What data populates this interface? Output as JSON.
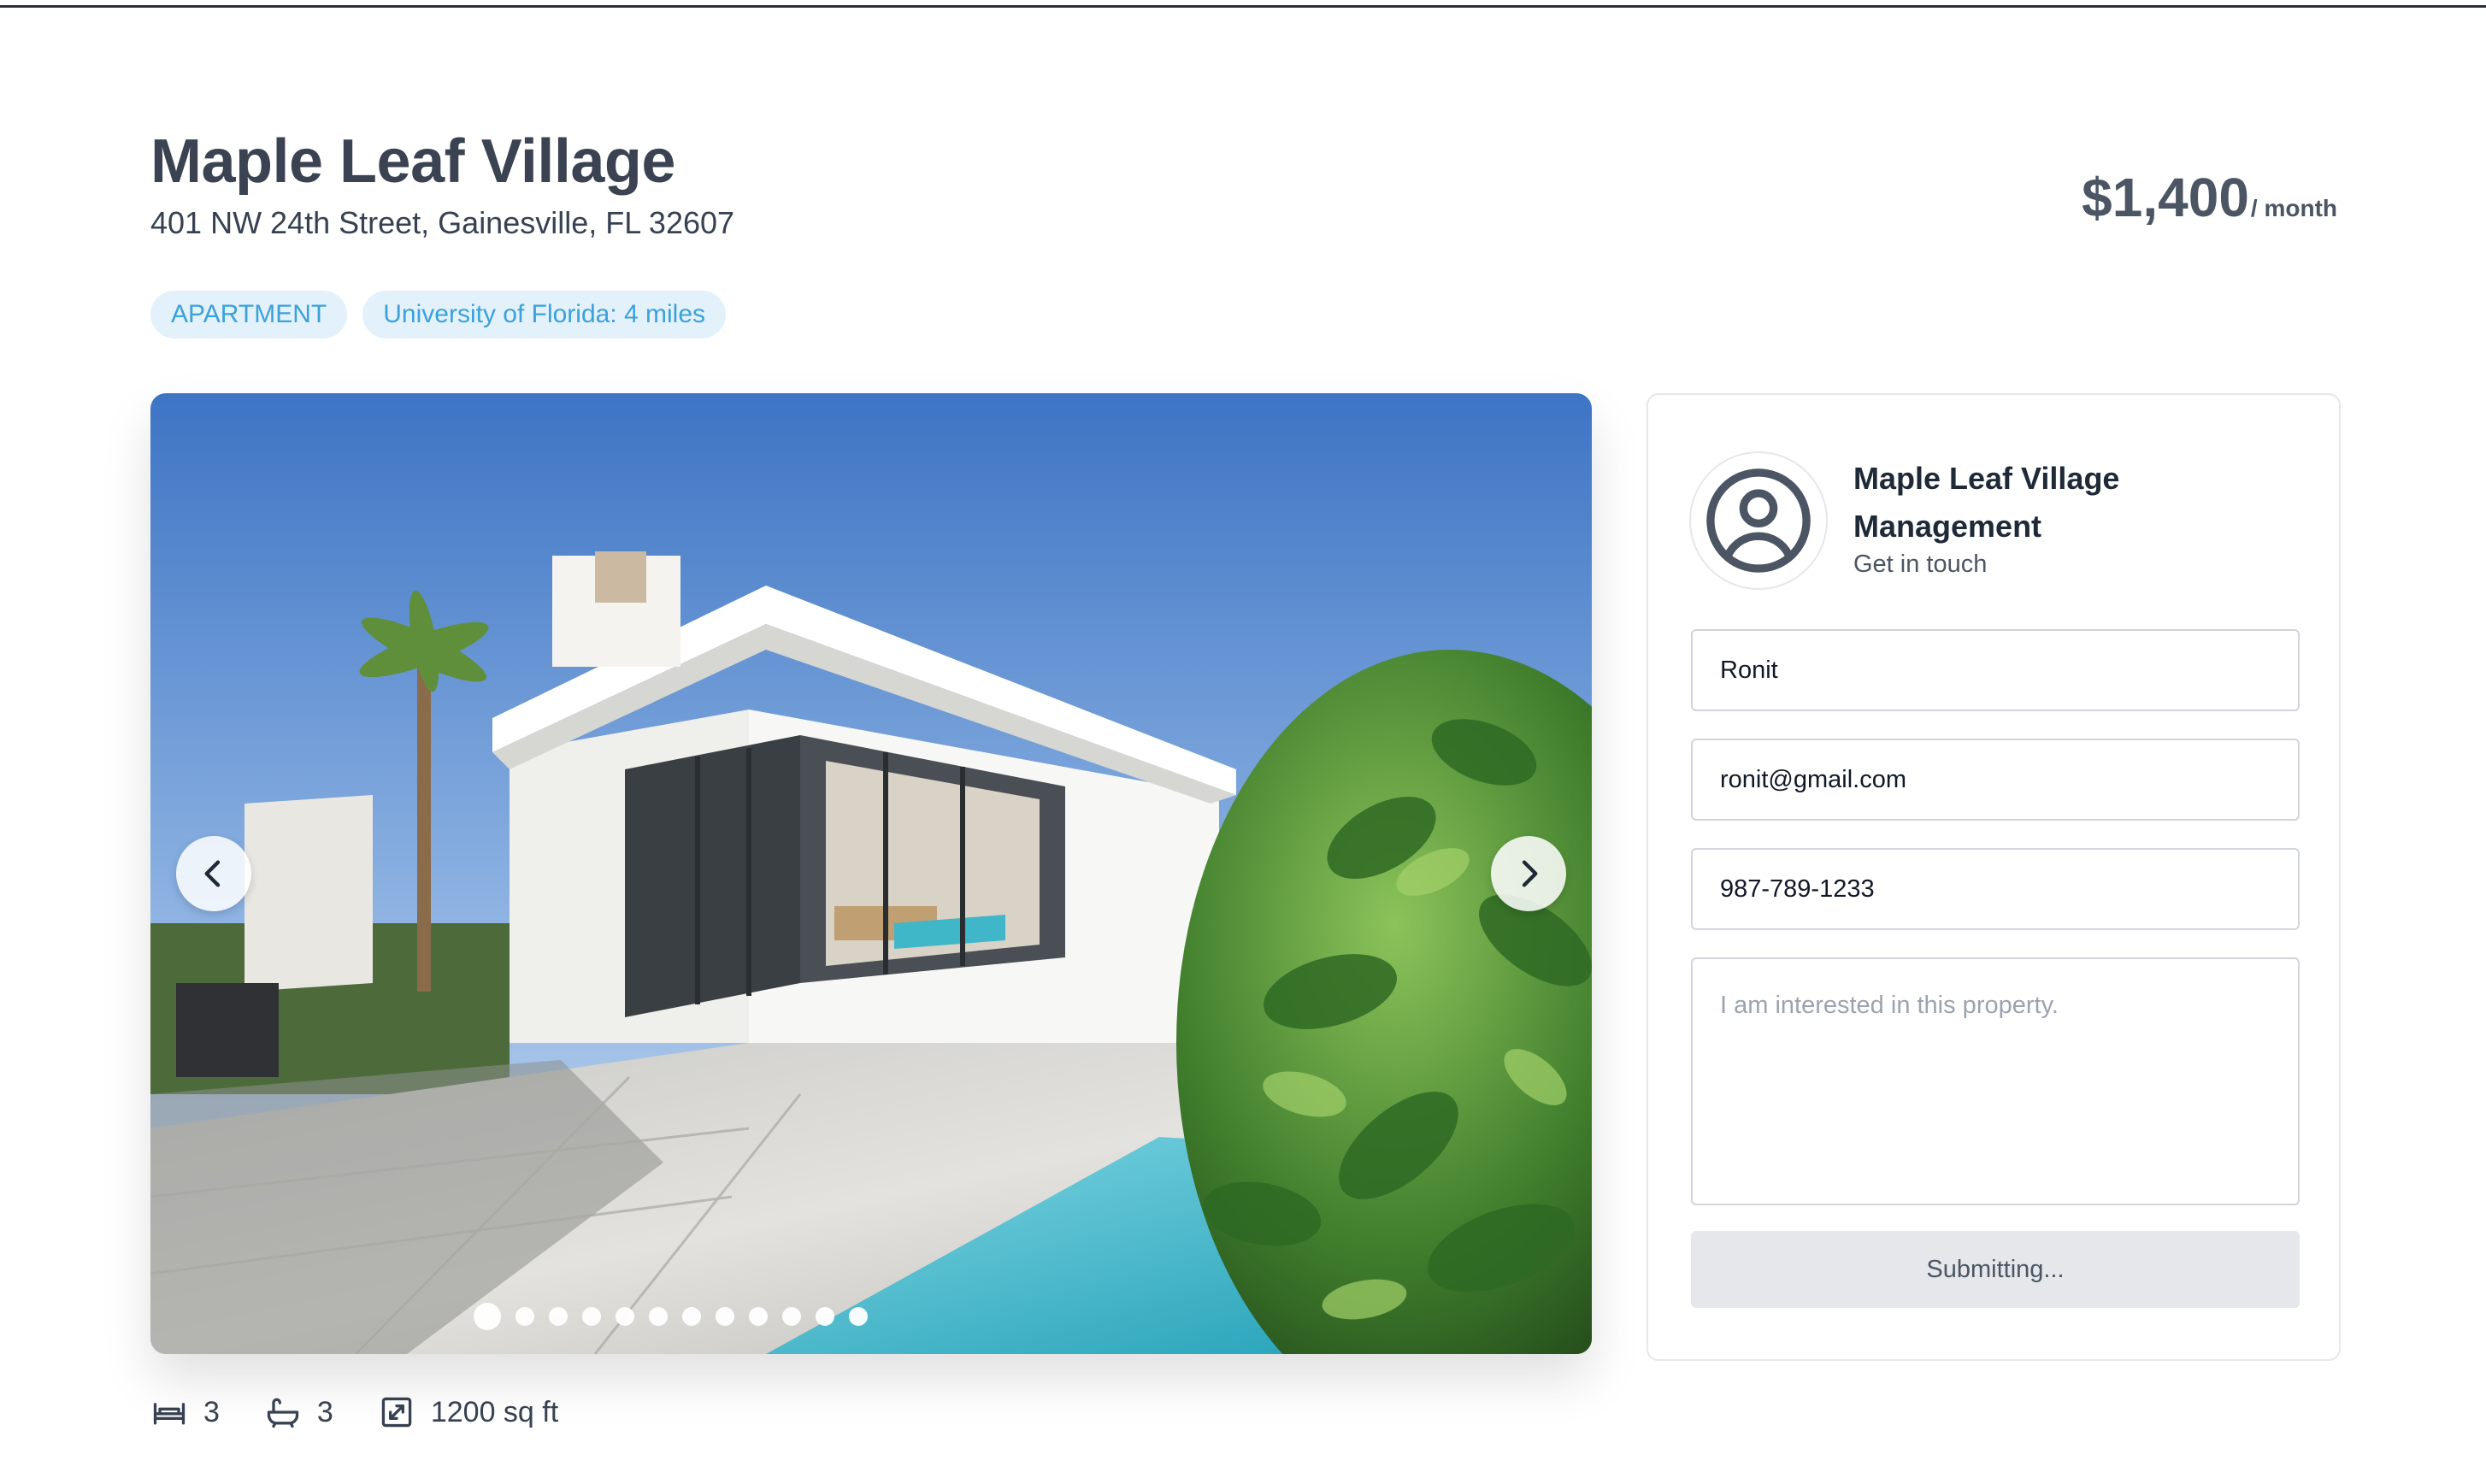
{
  "listing": {
    "title": "Maple Leaf Village",
    "address": "401 NW 24th Street, Gainesville, FL 32607",
    "price": "$1,400",
    "price_unit": "/ month",
    "tags": [
      "APARTMENT",
      "University of Florida: 4 miles"
    ]
  },
  "gallery": {
    "image_count": 12,
    "active_index": 0
  },
  "features": {
    "beds": "3",
    "baths": "3",
    "area": "1200 sq ft"
  },
  "contact": {
    "manager_name": "Maple Leaf Village Management",
    "subtitle": "Get in touch",
    "name_value": "Ronit",
    "email_value": "ronit@gmail.com",
    "phone_value": "987-789-1233",
    "message_placeholder": "I am interested in this property.",
    "submit_label": "Submitting..."
  },
  "colors": {
    "tag_bg": "#e3f1fb",
    "tag_text": "#3ba1da",
    "title": "#3b4252",
    "button_disabled_bg": "#e5e7eb"
  }
}
